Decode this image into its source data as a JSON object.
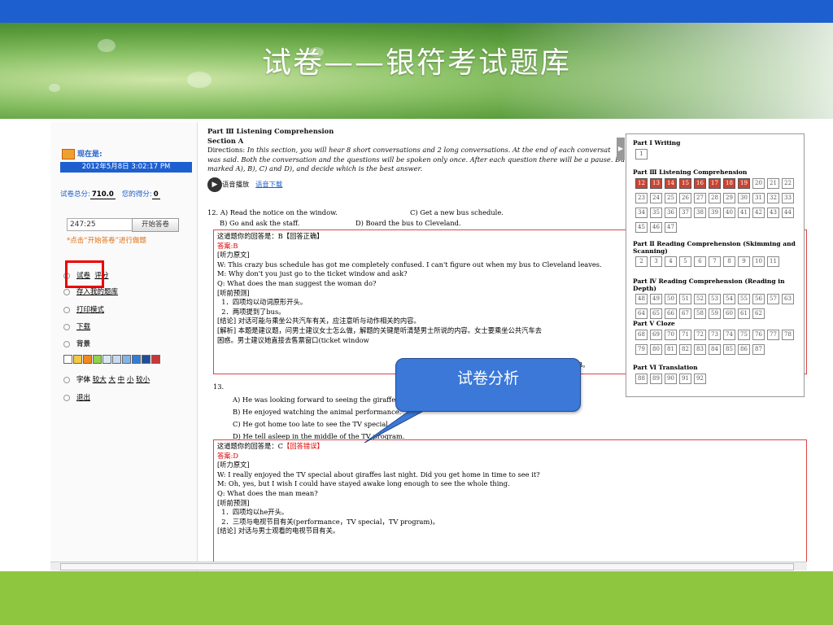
{
  "slide": {
    "title": "试卷——银符考试题库",
    "callout": "试卷分析"
  },
  "left_panel": {
    "location_label": "现在是:",
    "datetime": "2012年5月8日 3:02:17 PM",
    "total_score_label": "试卷总分:",
    "total_score": "710.0",
    "your_score_label": "您的得分:",
    "your_score": "0",
    "timer": "247:25",
    "start_button": "开始答卷",
    "hint": "*点击“开始答卷”进行做题",
    "review": "试卷",
    "score_link": "评分",
    "menu": [
      "存入我的题库",
      "打印模式",
      "下载"
    ],
    "background_label": "背景",
    "background_colors": [
      "#ffffff",
      "#f5c842",
      "#f08a1e",
      "#8fd14f",
      "#d6e8f7",
      "#c9d9f1",
      "#86b3e6",
      "#2f7fd8",
      "#1f4e9c",
      "#c83737"
    ],
    "font_label": "字体",
    "font_options": [
      "较大",
      "大",
      "中",
      "小",
      "较小"
    ],
    "exit": "退出"
  },
  "content": {
    "part": "Part Ⅲ  Listening Comprehension",
    "section": "Section A",
    "directions_label": "Directions:",
    "directions_l1": "In this section, you will hear 8 short conversations and 2 long conversations. At the end of each conversat",
    "directions_l2": "was said. Both the conversation and the questions will be spoken only once. After each question there will be a pause. Du",
    "directions_l3": "marked A), B), C) and D), and decide which is the best answer.",
    "audio_play": "语音播放",
    "audio_download": "语音下载",
    "q12": {
      "a": "12.  A) Read the notice on the window.",
      "c": "C) Get a new bus schedule.",
      "b": "B) Go and ask the staff.",
      "d": "D) Board the bus to Cleveland.",
      "your_answer": "这道题你的回答是：B【回答正确】",
      "answer_label": "答案:",
      "answer": "B",
      "lines": [
        "[听力原文]",
        "W: This crazy bus schedule has got me completely confused. I can't figure out when my bus to Cleveland leaves.",
        "M: Why don't you just go to the ticket window and ask?",
        "Q: What does the man suggest the woman do?",
        "[听前预测]",
        "  1．四项均以动词原形开头。",
        "  2．两项提到了bus。",
        "[结论] 对话可能与乘坐公共汽车有关，应注意听与动作相关的内容。",
        "[解析] 本题是建议题，问男士建议女士怎么做，解题的关键是听清楚男士所说的内容。女士要乘坐公共汽车去",
        "困惑。男士建议她直接去售票窗口(ticket window"
      ],
      "tail": "B。"
    },
    "q13": {
      "num": "13.",
      "options": [
        "A) He was looking forward to seeing the giraffes",
        "B) He enjoyed watching the animal performance.",
        "C) He got home too late to see the TV special.",
        "D) He tell asleep in the middle of the TV program."
      ],
      "your_answer_prefix": "这道题你的回答是：C",
      "your_answer_status": "【回答错误】",
      "answer_label": "答案:",
      "answer": "D",
      "lines": [
        "[听力原文]",
        "W: I really enjoyed the TV special about giraffes last night. Did you get home in time to see it?",
        "M: Oh, yes, but I wish I could have stayed awake long enough to see the whole thing.",
        "Q: What does the man mean?",
        "[听前预测]",
        "  1．四项均以he开头。",
        "  2．三项与电视节目有关(performance，TV special，TV program)。",
        "[结论] 对话与男士观看的电视节目有关。"
      ]
    }
  },
  "question_nav": {
    "sections": [
      {
        "title": "Part Ⅰ  Writing",
        "items": [
          1
        ],
        "done": []
      },
      {
        "title": "Part Ⅲ  Listening Comprehension",
        "items": [
          12,
          13,
          14,
          15,
          16,
          17,
          18,
          19,
          20,
          21,
          22,
          23,
          24,
          25,
          26,
          27,
          28,
          29,
          30,
          31,
          32,
          33,
          34,
          35,
          36,
          37,
          38,
          39,
          40,
          41,
          42,
          43,
          44,
          45,
          46,
          47
        ],
        "done": [
          12,
          13,
          14,
          15,
          16,
          17,
          18,
          19
        ]
      },
      {
        "title": "Part Ⅱ  Reading Comprehension (Skimming and Scanning)",
        "items": [
          2,
          3,
          4,
          5,
          6,
          7,
          8,
          9,
          10,
          11
        ],
        "done": []
      },
      {
        "title": "Part Ⅳ  Reading Comprehension (Reading in Depth)",
        "items": [
          48,
          49,
          50,
          51,
          52,
          53,
          54,
          55,
          56,
          57,
          63,
          64,
          65,
          66,
          67,
          58,
          59,
          60,
          61,
          62
        ],
        "done": []
      },
      {
        "title": "Part Ⅴ  Cloze",
        "items": [
          68,
          69,
          70,
          71,
          72,
          73,
          74,
          75,
          76,
          77,
          78,
          79,
          80,
          81,
          82,
          83,
          84,
          85,
          86,
          87
        ],
        "done": []
      },
      {
        "title": "Part Ⅵ  Translation",
        "items": [
          88,
          89,
          90,
          91,
          92
        ],
        "done": []
      }
    ]
  }
}
